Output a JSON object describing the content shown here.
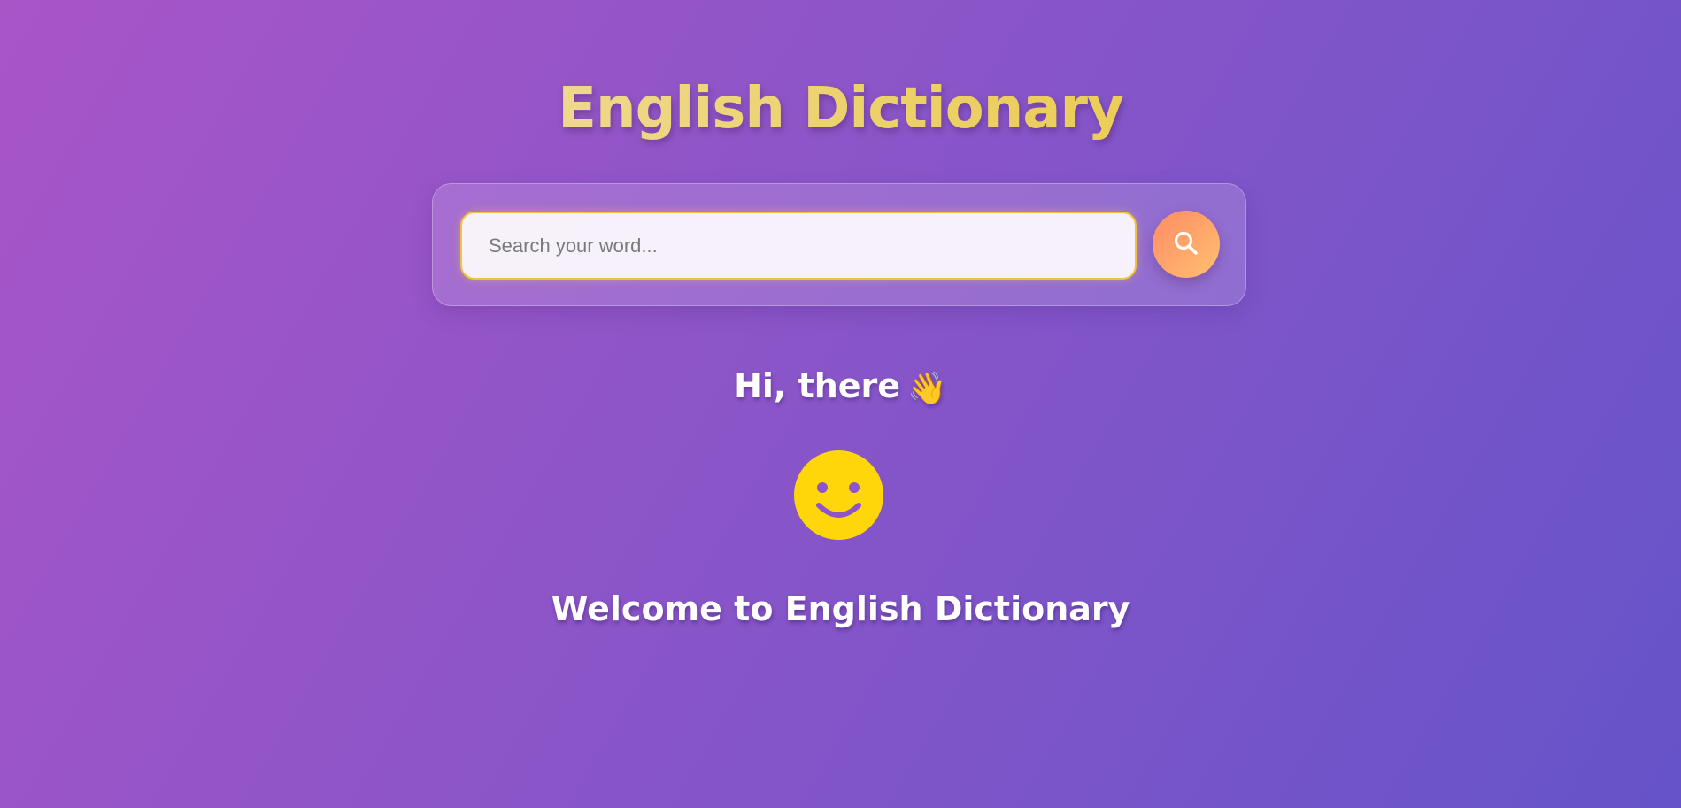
{
  "app": {
    "title": "English Dictionary"
  },
  "search": {
    "placeholder": "Search your word...",
    "value": "",
    "button_icon": "search-icon"
  },
  "greeting": {
    "text": "Hi, there",
    "emoji": "👋"
  },
  "illustration": {
    "icon": "smiley-face-icon",
    "color": "#ffd60a"
  },
  "welcome": {
    "text": "Welcome to English Dictionary"
  },
  "colors": {
    "background_start": "#a855c8",
    "background_end": "#6653c9",
    "title_gradient_start": "#f2e7c4",
    "title_gradient_end": "#e8c42a",
    "input_border": "#efc23f",
    "button_gradient_start": "#ff8c66",
    "button_gradient_end": "#ffc070"
  }
}
